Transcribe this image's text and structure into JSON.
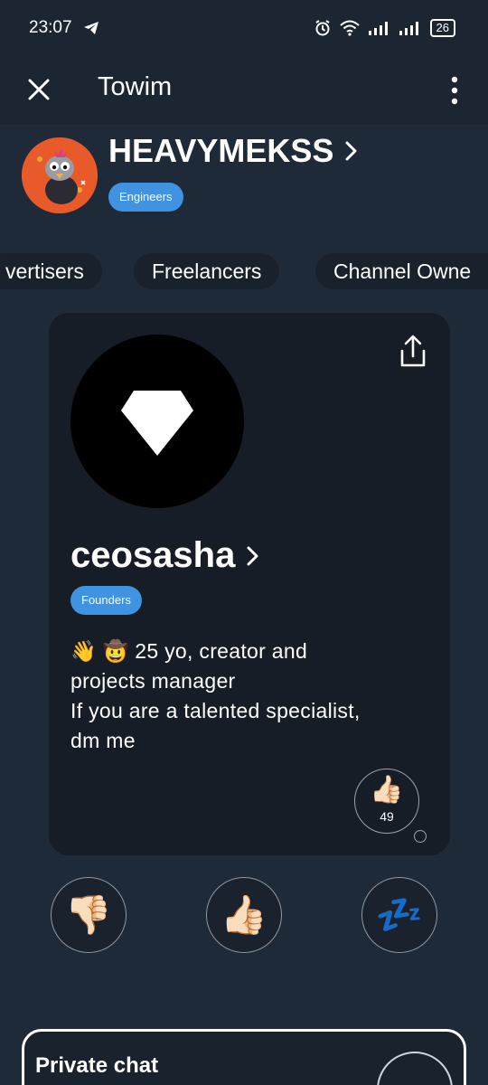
{
  "status_bar": {
    "time": "23:07",
    "battery": "26",
    "icons": [
      "telegram-icon",
      "alarm-icon",
      "wifi-icon",
      "signal-icon",
      "signal-icon",
      "battery-icon"
    ]
  },
  "app_bar": {
    "title": "Towim",
    "close_icon": "close-icon",
    "menu_icon": "more-vertical-icon"
  },
  "user": {
    "name": "HEAVYMEKSS",
    "badge": "Engineers"
  },
  "categories": [
    {
      "label": "vertisers"
    },
    {
      "label": "Freelancers"
    },
    {
      "label": "Channel Owne"
    }
  ],
  "profile_card": {
    "name": "ceosasha",
    "badge": "Founders",
    "bio": "👋 🤠 25 yo, creator and\nprojects manager\nIf you are a talented specialist,\ndm me",
    "likes": {
      "emoji": "👍🏻",
      "count": "49"
    }
  },
  "actions": [
    {
      "emoji": "👎🏻",
      "name": "dislike"
    },
    {
      "emoji": "👍🏻",
      "name": "like"
    },
    {
      "emoji": "💤",
      "name": "sleep"
    }
  ],
  "private_chat": {
    "label": "Private chat"
  },
  "colors": {
    "background": "#1f2a38",
    "card": "#171d26",
    "badge": "#3f93e0",
    "avatar": "#e85a2a"
  }
}
